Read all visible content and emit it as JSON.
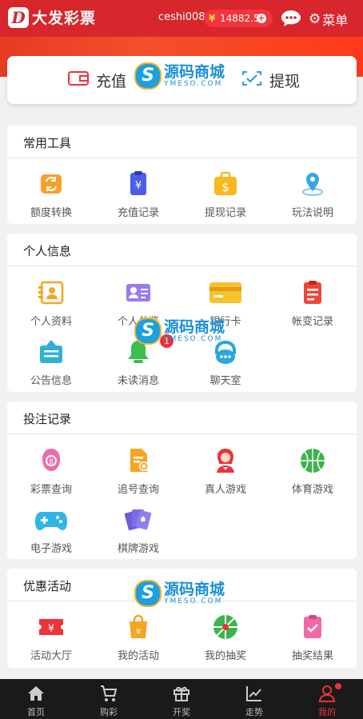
{
  "header": {
    "logo_mark": "D",
    "logo_text": "大发彩票",
    "username": "ceshi008",
    "currency_symbol": "¥",
    "balance": "14882.5",
    "plus": "+",
    "menu_label": "菜单"
  },
  "top_actions": {
    "recharge": "充值",
    "withdraw": "提现"
  },
  "watermark": {
    "letter": "S",
    "cn": "源码商城",
    "en": "YMESO.COM"
  },
  "sections": {
    "tools": {
      "title": "常用工具",
      "items": [
        {
          "label": "额度转换",
          "icon": "exchange-icon"
        },
        {
          "label": "充值记录",
          "icon": "recharge-record-icon"
        },
        {
          "label": "提现记录",
          "icon": "withdraw-record-icon"
        },
        {
          "label": "玩法说明",
          "icon": "location-pin-icon"
        }
      ]
    },
    "personal": {
      "title": "个人信息",
      "items": [
        {
          "label": "个人资料",
          "icon": "profile-card-icon"
        },
        {
          "label": "个人总览",
          "icon": "overview-icon"
        },
        {
          "label": "银行卡",
          "icon": "bank-card-icon"
        },
        {
          "label": "帐变记录",
          "icon": "account-change-icon"
        },
        {
          "label": "公告信息",
          "icon": "notice-icon"
        },
        {
          "label": "未读消息",
          "icon": "bell-icon",
          "badge": "1"
        },
        {
          "label": "聊天室",
          "icon": "chat-room-icon"
        }
      ]
    },
    "bets": {
      "title": "投注记录",
      "items": [
        {
          "label": "彩票查询",
          "icon": "lottery-query-icon"
        },
        {
          "label": "追号查询",
          "icon": "chase-query-icon"
        },
        {
          "label": "真人游戏",
          "icon": "live-dealer-icon"
        },
        {
          "label": "体育游戏",
          "icon": "basketball-icon"
        },
        {
          "label": "电子游戏",
          "icon": "gamepad-icon"
        },
        {
          "label": "棋牌游戏",
          "icon": "cards-icon"
        }
      ]
    },
    "promo": {
      "title": "优惠活动",
      "items": [
        {
          "label": "活动大厅",
          "icon": "ticket-icon"
        },
        {
          "label": "我的活动",
          "icon": "shopping-bag-icon"
        },
        {
          "label": "我的抽奖",
          "icon": "lottery-wheel-icon"
        },
        {
          "label": "抽奖结果",
          "icon": "result-clipboard-icon"
        }
      ]
    }
  },
  "tabbar": [
    {
      "label": "首页",
      "icon": "home-icon"
    },
    {
      "label": "购彩",
      "icon": "cart-icon"
    },
    {
      "label": "开奖",
      "icon": "gift-icon"
    },
    {
      "label": "走势",
      "icon": "trend-icon"
    },
    {
      "label": "我的",
      "icon": "user-icon",
      "active": true
    }
  ],
  "colors": {
    "brand": "#d7262c",
    "accent": "#e8333a",
    "tab_bg": "#1a1a1a"
  }
}
